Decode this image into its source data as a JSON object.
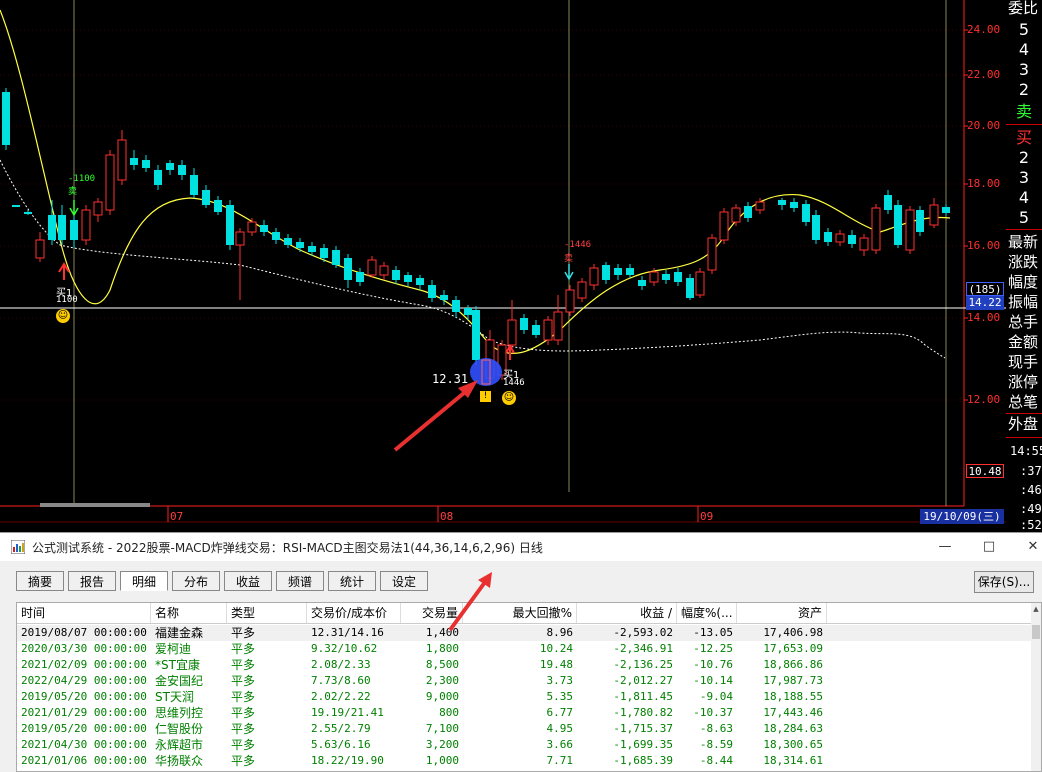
{
  "chart": {
    "price_axis": [
      "24.00",
      "22.00",
      "20.00",
      "18.00",
      "16.00",
      "14.00",
      "12.00"
    ],
    "current_price": "14.22",
    "count_badge": "(185)",
    "low_price": "10.48",
    "month_labels": [
      "07",
      "08",
      "09"
    ],
    "date_box": "19/10/09(三)",
    "low_annotation": "12.31",
    "buy_signal_1": {
      "label": "买1",
      "qty": "1100",
      "marker": "-1100",
      "sell_mark": "卖"
    },
    "buy_signal_2": {
      "label": "买1",
      "qty": "1446",
      "marker": "-1446",
      "sell_mark": "卖"
    },
    "colors": {
      "up": "#ff3030",
      "down": "#00e0e0",
      "ma": "#ffff40",
      "axis": "#ff2020"
    }
  },
  "right_panel": {
    "header": "委比",
    "sell_levels": [
      "5",
      "4",
      "3",
      "2"
    ],
    "sell_label": "卖",
    "buy_label": "买",
    "buy_levels": [
      "2",
      "3",
      "4",
      "5"
    ],
    "labels": [
      "最新",
      "涨跌",
      "幅度",
      "振幅",
      "总手",
      "金额",
      "现手",
      "涨停",
      "总笔",
      "外盘"
    ],
    "times": [
      "14:55",
      ":37",
      ":46",
      ":49",
      ":52"
    ]
  },
  "dialog": {
    "title": "公式测试系统 - 2022股票-MACD炸弹线交易：RSI-MACD主图交易法1(44,36,14,6,2,96) 日线",
    "window_buttons": {
      "minimize": "—",
      "maximize": "□",
      "close": "✕"
    },
    "tabs": [
      "摘要",
      "报告",
      "明细",
      "分布",
      "收益",
      "频谱",
      "统计",
      "设定"
    ],
    "active_tab": "明细",
    "save_label": "保存(S)...",
    "columns": [
      "时间",
      "名称",
      "类型",
      "交易价/成本价",
      "交易量",
      "最大回撤%",
      "收益 /",
      "幅度%(...",
      "资产"
    ],
    "rows": [
      {
        "time": "2019/08/07 00:00:00",
        "name": "福建金森",
        "type": "平多",
        "price": "12.31/14.16",
        "qty": "1,400",
        "drawdown": "8.96",
        "profit": "-2,593.02",
        "pct": "-13.05",
        "asset": "17,406.98"
      },
      {
        "time": "2020/03/30 00:00:00",
        "name": "爱柯迪",
        "type": "平多",
        "price": "9.32/10.62",
        "qty": "1,800",
        "drawdown": "10.24",
        "profit": "-2,346.91",
        "pct": "-12.25",
        "asset": "17,653.09"
      },
      {
        "time": "2021/02/09 00:00:00",
        "name": "*ST宜康",
        "type": "平多",
        "price": "2.08/2.33",
        "qty": "8,500",
        "drawdown": "19.48",
        "profit": "-2,136.25",
        "pct": "-10.76",
        "asset": "18,866.86"
      },
      {
        "time": "2022/04/29 00:00:00",
        "name": "金安国纪",
        "type": "平多",
        "price": "7.73/8.60",
        "qty": "2,300",
        "drawdown": "3.73",
        "profit": "-2,012.27",
        "pct": "-10.14",
        "asset": "17,987.73"
      },
      {
        "time": "2019/05/20 00:00:00",
        "name": "ST天润",
        "type": "平多",
        "price": "2.02/2.22",
        "qty": "9,000",
        "drawdown": "5.35",
        "profit": "-1,811.45",
        "pct": "-9.04",
        "asset": "18,188.55"
      },
      {
        "time": "2021/01/29 00:00:00",
        "name": "思维列控",
        "type": "平多",
        "price": "19.19/21.41",
        "qty": "800",
        "drawdown": "6.77",
        "profit": "-1,780.82",
        "pct": "-10.37",
        "asset": "17,443.46"
      },
      {
        "time": "2019/05/20 00:00:00",
        "name": "仁智股份",
        "type": "平多",
        "price": "2.55/2.79",
        "qty": "7,100",
        "drawdown": "4.95",
        "profit": "-1,715.37",
        "pct": "-8.63",
        "asset": "18,284.63"
      },
      {
        "time": "2021/04/30 00:00:00",
        "name": "永辉超市",
        "type": "平多",
        "price": "5.63/6.16",
        "qty": "3,200",
        "drawdown": "3.66",
        "profit": "-1,699.35",
        "pct": "-8.59",
        "asset": "18,300.65"
      },
      {
        "time": "2021/01/06 00:00:00",
        "name": "华扬联众",
        "type": "平多",
        "price": "18.22/19.90",
        "qty": "1,000",
        "drawdown": "7.71",
        "profit": "-1,685.39",
        "pct": "-8.44",
        "asset": "18,314.61"
      }
    ]
  }
}
